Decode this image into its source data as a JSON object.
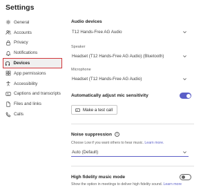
{
  "window": {
    "title": "Settings"
  },
  "sidebar": {
    "items": [
      {
        "label": "General",
        "icon": "gear-icon"
      },
      {
        "label": "Accounts",
        "icon": "accounts-icon"
      },
      {
        "label": "Privacy",
        "icon": "lock-icon"
      },
      {
        "label": "Notifications",
        "icon": "bell-icon"
      },
      {
        "label": "Devices",
        "icon": "headset-icon",
        "active": true
      },
      {
        "label": "App permissions",
        "icon": "grid-icon"
      },
      {
        "label": "Accessibility",
        "icon": "accessibility-icon"
      },
      {
        "label": "Captions and transcripts",
        "icon": "captions-icon"
      },
      {
        "label": "Files and links",
        "icon": "document-icon"
      },
      {
        "label": "Calls",
        "icon": "phone-icon"
      }
    ]
  },
  "devices": {
    "audio_heading": "Audio devices",
    "audio_value": "T12 Hands-Free AG Audio",
    "speaker_label": "Speaker",
    "speaker_value": "Headset (T12 Hands-Free AG Audio) (Bluetooth)",
    "mic_label": "Microphone",
    "mic_value": "Headset (T12 Hands-Free AG Audio)",
    "auto_adjust_label": "Automatically adjust mic sensitivity",
    "auto_adjust_on": true,
    "test_call_label": "Make a test call",
    "noise_heading": "Noise suppression",
    "noise_helper": "Choose Low if you want others to hear music.",
    "noise_link": "Learn more.",
    "noise_value": "Auto (Default)",
    "hifi_label": "High fidelity music mode",
    "hifi_on": false,
    "hifi_helper": "Show the option in meetings to deliver high fidelity sound.",
    "hifi_link": "Learn more"
  },
  "colors": {
    "accent": "#5b5fc7",
    "highlight_box": "#d13438"
  }
}
